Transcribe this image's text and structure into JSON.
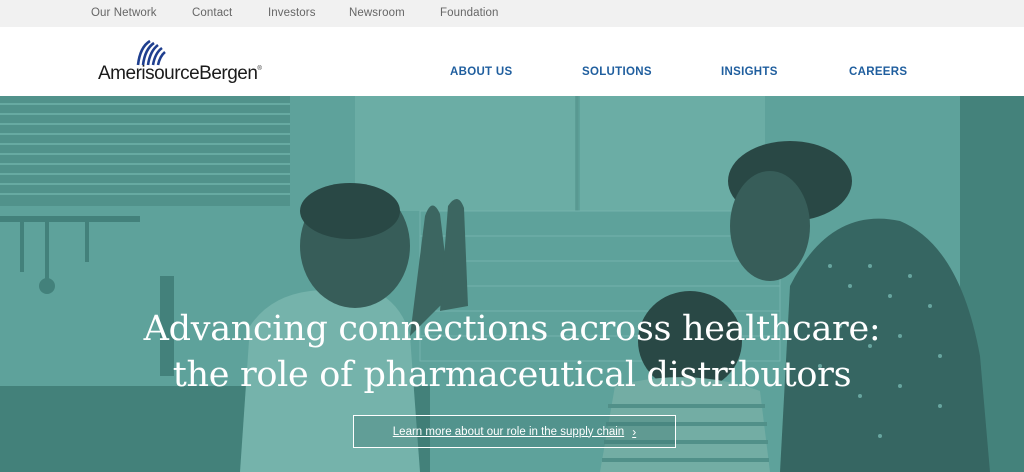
{
  "utility_nav": {
    "items": [
      "Our Network",
      "Contact",
      "Investors",
      "Newsroom",
      "Foundation"
    ]
  },
  "logo": {
    "text": "AmerisourceBergen",
    "mark": "®"
  },
  "main_nav": {
    "items": [
      "ABOUT US",
      "SOLUTIONS",
      "INSIGHTS",
      "CAREERS"
    ]
  },
  "hero": {
    "title_line1": "Advancing connections across healthcare:",
    "title_line2": "the role of pharmaceutical distributors",
    "cta_label": "Learn more about our role in the supply chain",
    "cta_icon": "chevron-right-icon"
  },
  "colors": {
    "utility_bg": "#f1f1f1",
    "nav_blue": "#1f5e9e",
    "hero_teal": "#5fa39b"
  }
}
